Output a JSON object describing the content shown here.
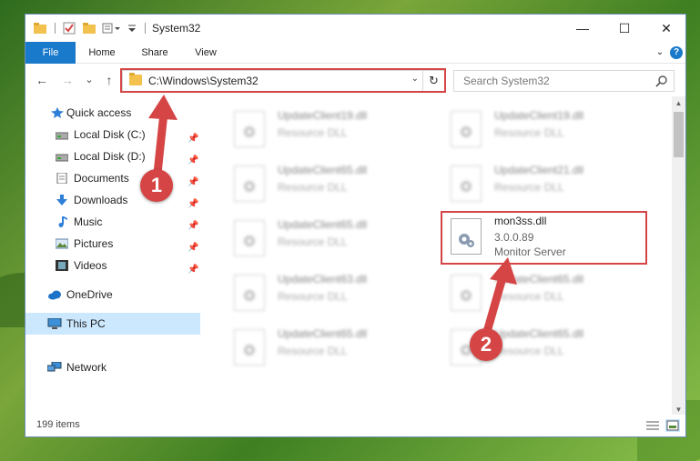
{
  "window": {
    "title": "System32",
    "controls": {
      "minimize": "—",
      "maximize": "☐",
      "close": "✕"
    }
  },
  "ribbon": {
    "tabs": [
      "File",
      "Home",
      "Share",
      "View"
    ],
    "collapse": "⌄",
    "help": "?"
  },
  "nav": {
    "back": "←",
    "forward": "→",
    "recent": "⌄",
    "up": "↑",
    "address": "C:\\Windows\\System32",
    "address_dropdown": "⌄",
    "refresh": "↻",
    "search_placeholder": "Search System32"
  },
  "sidebar": {
    "items": [
      {
        "label": "Quick access",
        "icon": "star-icon",
        "pinned": false
      },
      {
        "label": "Local Disk (C:)",
        "icon": "drive-icon",
        "pinned": true
      },
      {
        "label": "Local Disk (D:)",
        "icon": "drive-icon",
        "pinned": true
      },
      {
        "label": "Documents",
        "icon": "documents-icon",
        "pinned": true
      },
      {
        "label": "Downloads",
        "icon": "download-icon",
        "pinned": true
      },
      {
        "label": "Music",
        "icon": "music-icon",
        "pinned": true
      },
      {
        "label": "Pictures",
        "icon": "pictures-icon",
        "pinned": true
      },
      {
        "label": "Videos",
        "icon": "videos-icon",
        "pinned": true
      },
      {
        "label": "OneDrive",
        "icon": "cloud-icon",
        "pinned": false
      },
      {
        "label": "This PC",
        "icon": "computer-icon",
        "pinned": false
      },
      {
        "label": "Network",
        "icon": "network-icon",
        "pinned": false
      }
    ],
    "pin_glyph": "📌"
  },
  "files": {
    "left": [
      {
        "name": "UpdateClient19.dll",
        "desc": "Resource DLL"
      },
      {
        "name": "UpdateClient65.dll",
        "desc": "Resource DLL"
      },
      {
        "name": "UpdateClient65.dll",
        "desc": "Resource DLL"
      },
      {
        "name": "UpdateClient63.dll",
        "desc": "Resource DLL"
      },
      {
        "name": "UpdateClient65.dll",
        "desc": "Resource DLL"
      }
    ],
    "right": [
      {
        "name": "UpdateClient19.dll",
        "desc": "Resource DLL"
      },
      {
        "name": "UpdateClient21.dll",
        "desc": "Resource DLL"
      },
      {
        "name": "UpdateClient65.dll",
        "desc": "Resource DLL"
      },
      {
        "name": "UpdateClient65.dll",
        "desc": "Resource DLL"
      }
    ],
    "highlighted": {
      "name": "mon3ss.dll",
      "version": "3.0.0.89",
      "desc": "Monitor Server"
    }
  },
  "status": {
    "count": "199 items"
  },
  "annotations": {
    "step1": "1",
    "step2": "2",
    "color": "#d64545"
  },
  "scroll": {
    "up": "▲",
    "down": "▼"
  }
}
